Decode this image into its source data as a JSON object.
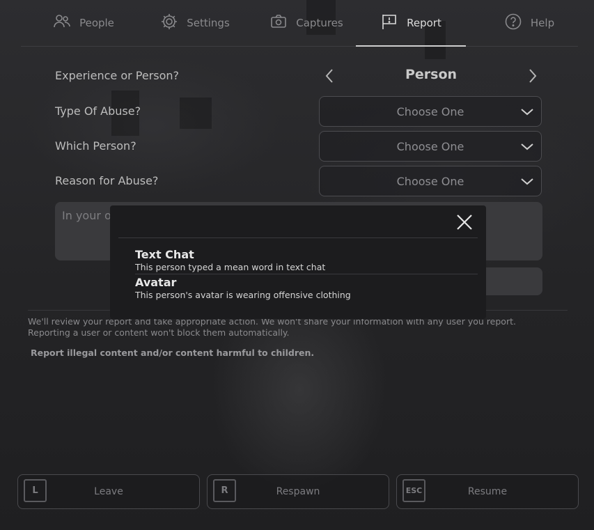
{
  "tabs": [
    {
      "label": "People",
      "icon": "people-icon",
      "active": false
    },
    {
      "label": "Settings",
      "icon": "gear-icon",
      "active": false
    },
    {
      "label": "Captures",
      "icon": "camera-icon",
      "active": false
    },
    {
      "label": "Report",
      "icon": "flag-icon",
      "active": true
    },
    {
      "label": "Help",
      "icon": "help-icon",
      "active": false
    }
  ],
  "form": {
    "experience_or_person_label": "Experience or Person?",
    "experience_or_person_value": "Person",
    "type_of_abuse_label": "Type Of Abuse?",
    "type_of_abuse_value": "Choose One",
    "which_person_label": "Which Person?",
    "which_person_value": "Choose One",
    "reason_label": "Reason for Abuse?",
    "reason_value": "Choose One",
    "comment_placeholder": "In your o"
  },
  "note": "We'll review your report and take appropriate action. We won't share your information with any user you report. Reporting a user or content won't block them automatically.",
  "illegal_link": "Report illegal content and/or content harmful to children.",
  "popup": {
    "options": [
      {
        "title": "Text Chat",
        "description": "This person typed a mean word in text chat"
      },
      {
        "title": "Avatar",
        "description": "This person's avatar is wearing offensive clothing"
      }
    ]
  },
  "bottom": {
    "leave": {
      "key": "L",
      "label": "Leave"
    },
    "respawn": {
      "key": "R",
      "label": "Respawn"
    },
    "resume": {
      "key": "ESC",
      "label": "Resume"
    }
  },
  "colors": {
    "active_tab": "#dcdcdc",
    "inactive_tab": "#8a8a8d",
    "popup_bg": "#1c1c1e"
  }
}
